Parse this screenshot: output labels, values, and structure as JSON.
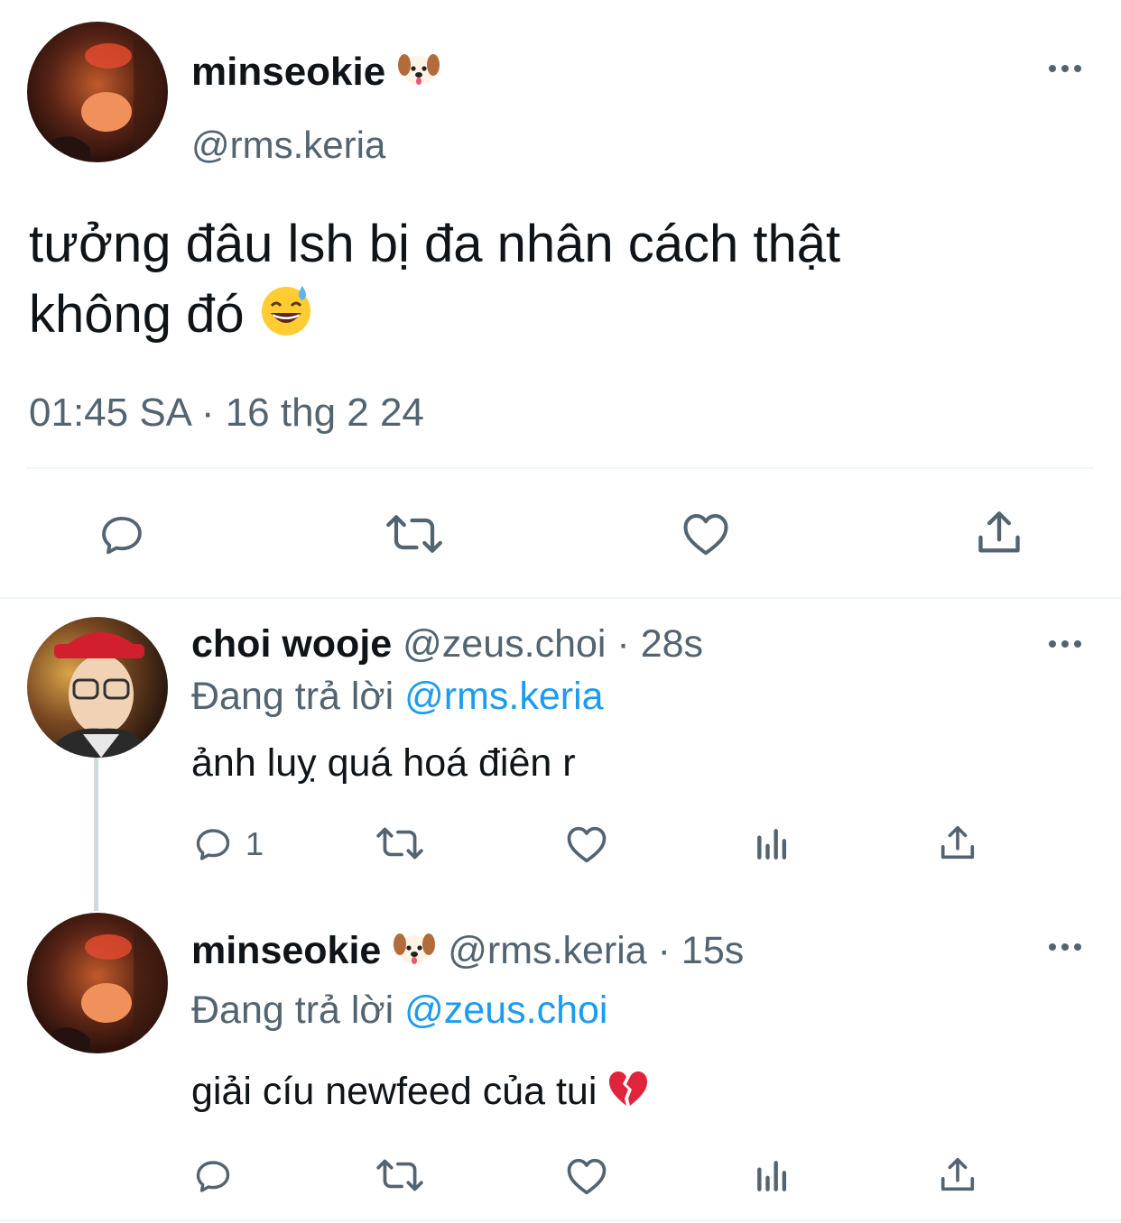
{
  "main_tweet": {
    "display_name": "minseokie",
    "name_emoji": "dog-face-emoji",
    "handle": "@rms.keria",
    "text_line1": "tưởng đâu lsh bị đa nhân cách thật",
    "text_line2": "không đó",
    "text_emoji": "grinning-face-with-sweat-emoji",
    "timestamp": "01:45 SA · 16 thg 2 24"
  },
  "replies": [
    {
      "display_name": "choi wooje",
      "handle": "@zeus.choi",
      "sep": "·",
      "time": "28s",
      "replying_prefix": "Đang trả lời",
      "replying_to": "@rms.keria",
      "text": "ảnh luỵ quá hoá điên r",
      "reply_count": "1"
    },
    {
      "display_name": "minseokie",
      "name_emoji": "dog-face-emoji",
      "handle": "@rms.keria",
      "sep": "·",
      "time": "15s",
      "replying_prefix": "Đang trả lời",
      "replying_to": "@zeus.choi",
      "text": "giải cíu newfeed của tui",
      "text_emoji": "broken-heart-emoji",
      "reply_count": ""
    }
  ],
  "colors": {
    "text": "#0f1419",
    "secondary": "#536471",
    "link": "#1d9bf0",
    "divider": "#eff3f4",
    "thread_line": "#cfd9de"
  }
}
